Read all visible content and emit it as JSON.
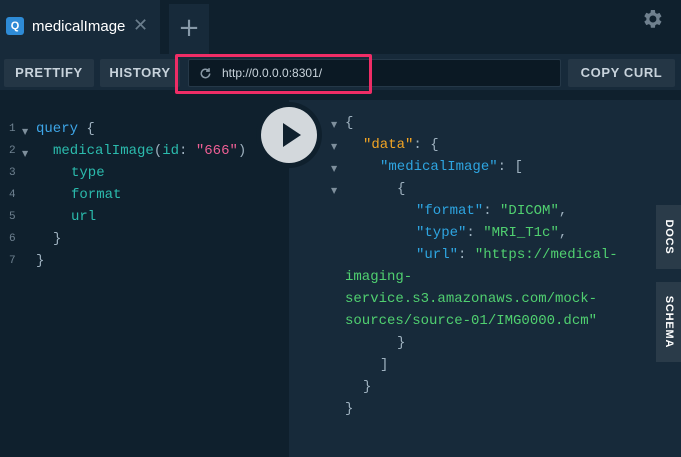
{
  "tabs": [
    {
      "badge": "Q",
      "title": "medicalImage",
      "close": "✕"
    }
  ],
  "add_tab": "+",
  "settings": {
    "icon": "gear-icon"
  },
  "toolbar": {
    "prettify_label": "PRETTIFY",
    "history_label": "HISTORY",
    "url": "http://0.0.0.0:8301/",
    "copy_curl_label": "COPY CURL"
  },
  "editor": {
    "line_numbers": [
      "1",
      "2",
      "3",
      "4",
      "5",
      "6",
      "7"
    ],
    "tokens": {
      "query_kw": "query",
      "open_brace": " {",
      "root_field": "medicalImage",
      "paren_open": "(",
      "arg_name": "id",
      "colon": ": ",
      "arg_value": "\"666\"",
      "paren_close": ")",
      "field_type": "type",
      "field_format": "format",
      "field_url": "url",
      "close_brace_inner": "}",
      "close_brace_outer": "}"
    }
  },
  "results": {
    "open_brace": "{",
    "data_key": "\"data\"",
    "image_key": "\"medicalImage\"",
    "open_bracket": "[",
    "item_open": "{",
    "format_key": "\"format\"",
    "format_value": "\"DICOM\"",
    "type_key": "\"type\"",
    "type_value": "\"MRI_T1c\"",
    "url_key": "\"url\"",
    "url_value_lines": [
      "\"https://medical-",
      "imaging-",
      "service.s3.amazonaws.com/mock-",
      "sources/source-01/IMG0000.dcm\""
    ],
    "item_close": "}",
    "close_bracket": "]",
    "data_close": "}",
    "close_brace": "}"
  },
  "side_tabs": {
    "docs": "DOCS",
    "schema": "SCHEMA"
  },
  "colors": {
    "background": "#0f202d",
    "panel": "#172a3a",
    "keyword": "#3ea6e8",
    "field": "#2bbbad",
    "string_arg": "#ef5f95",
    "json_key": "#2ea5e1",
    "data_key": "#f3a524",
    "json_string": "#50d070",
    "highlight": "#ef2d66"
  }
}
